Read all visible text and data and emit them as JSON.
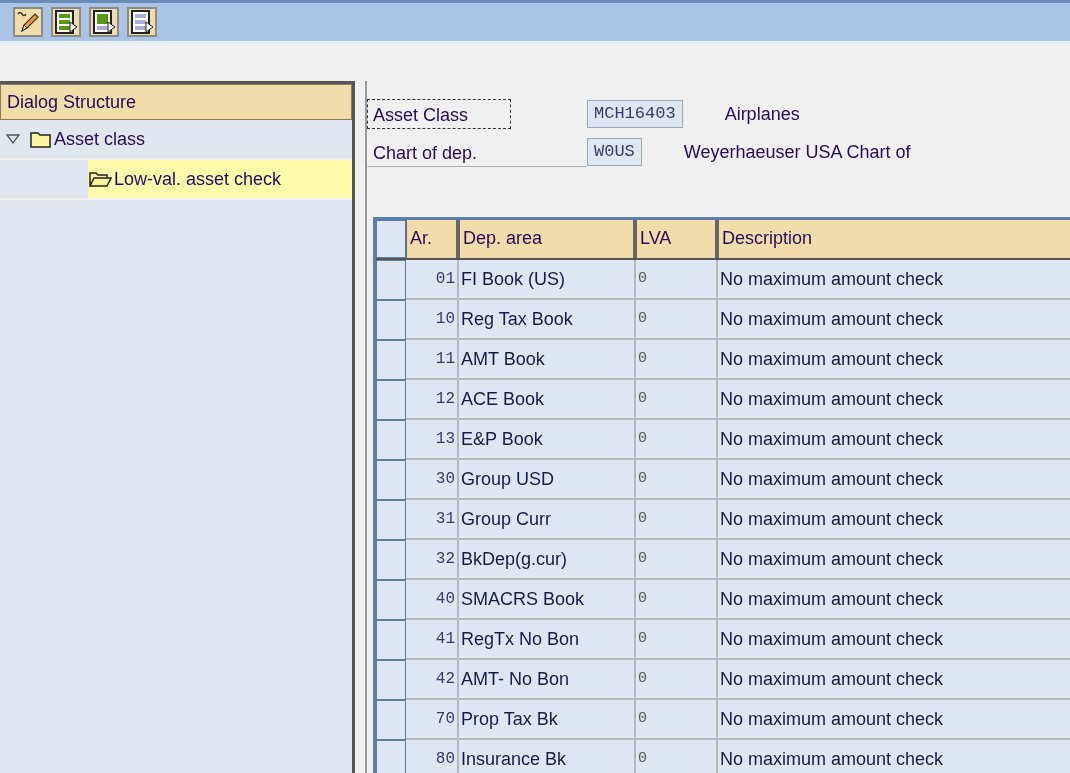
{
  "toolbar": {
    "buttons": [
      {
        "kind": "edit"
      },
      {
        "kind": "green-rows"
      },
      {
        "kind": "green-block"
      },
      {
        "kind": "plain-rows"
      }
    ]
  },
  "dialog_structure": {
    "title": "Dialog Structure",
    "tree": [
      {
        "label": "Asset class",
        "expanded": true,
        "selected": false,
        "children": [
          {
            "label": "Low-val. asset check",
            "expanded": true,
            "selected": true
          }
        ]
      }
    ]
  },
  "header_fields": [
    {
      "label": "Asset Class",
      "value": "MCH16403",
      "description": "Airplanes",
      "focused": true
    },
    {
      "label": "Chart of dep.",
      "value": "W0US",
      "description": "Weyerhaeuser USA Chart of",
      "focused": false
    }
  ],
  "table": {
    "columns": [
      "Ar.",
      "Dep. area",
      "LVA",
      "Description"
    ],
    "rows": [
      {
        "area": "01",
        "name": "FI Book (US)",
        "lva": "0",
        "description": "No maximum amount check"
      },
      {
        "area": "10",
        "name": "Reg Tax Book",
        "lva": "0",
        "description": "No maximum amount check"
      },
      {
        "area": "11",
        "name": "AMT Book",
        "lva": "0",
        "description": "No maximum amount check"
      },
      {
        "area": "12",
        "name": "ACE Book",
        "lva": "0",
        "description": "No maximum amount check"
      },
      {
        "area": "13",
        "name": "E&P Book",
        "lva": "0",
        "description": "No maximum amount check"
      },
      {
        "area": "30",
        "name": "Group USD",
        "lva": "0",
        "description": "No maximum amount check"
      },
      {
        "area": "31",
        "name": "Group Curr",
        "lva": "0",
        "description": "No maximum amount check"
      },
      {
        "area": "32",
        "name": "BkDep(g.cur)",
        "lva": "0",
        "description": "No maximum amount check"
      },
      {
        "area": "40",
        "name": "SMACRS Book",
        "lva": "0",
        "description": "No maximum amount check"
      },
      {
        "area": "41",
        "name": "RegTx No Bon",
        "lva": "0",
        "description": "No maximum amount check"
      },
      {
        "area": "42",
        "name": "AMT- No Bon",
        "lva": "0",
        "description": "No maximum amount check"
      },
      {
        "area": "70",
        "name": "Prop Tax Bk",
        "lva": "0",
        "description": "No maximum amount check"
      },
      {
        "area": "80",
        "name": "Insurance Bk",
        "lva": "0",
        "description": "No maximum amount check"
      }
    ]
  }
}
